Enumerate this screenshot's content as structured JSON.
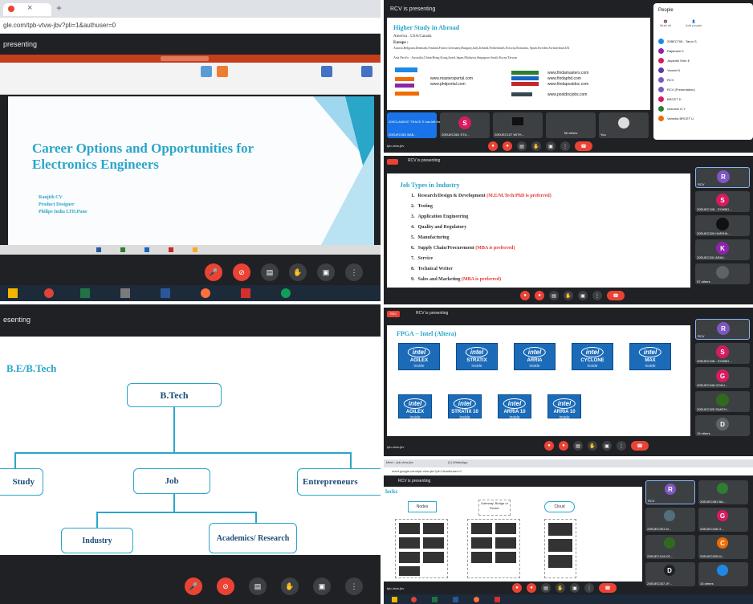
{
  "p1": {
    "url": "gle.com/tpb-vtvw-jbv?pli=1&authuser=0",
    "presenting": "presenting",
    "title": "Career Options and Opportunities for Electronics Engineers",
    "author": [
      "Ranjith CV",
      "Product Designer",
      "Philips India LTD,Pune"
    ]
  },
  "p2": {
    "presenting": "RCV is presenting",
    "slide_title": "Higher Study in Abroad",
    "america": "America : USA/Canada",
    "europe_label": "Europe :",
    "europe": "Austria,Belgium,Denmark,Finland,France,Germany,Hungary,Italy,Ireland,Netherlands,Norway,Romania, Spain,Sweden,Switzerland,UK",
    "asia": "Asia Pacific : Australia,China,Hong Kong,Israel,Japan,Malaysia,Singapore,South Korea,Taiwan",
    "sites_left": [
      "www.mastersportal.com",
      "www.phdportal.com"
    ],
    "sites_right": [
      "www.findamasters.com",
      "www.findaphd.com",
      "www.findapostdoc.com",
      "www.postdocjobs.com"
    ],
    "people_title": "People",
    "people_actions": [
      "Mute all",
      "Add people"
    ],
    "people": [
      "20BEC708 - Tarun S",
      "Rajamahi C",
      "Jayanthi Sree E",
      "Yamini N",
      "RCV",
      "RCV (Presentation)",
      "BRCET D",
      "sharmini D.Y",
      "Vamsha BRCET U"
    ],
    "toast": "20ECLA08037 TRACE S has left the meeting",
    "tile_labels": [
      "20EUEC081 BAB...",
      "20EUEC081 STU...",
      "20EUEC107 WITH...",
      "56 others",
      "You"
    ],
    "tile_letter": "S",
    "footer": "tpb-vtvw-jbv"
  },
  "p3": {
    "presenting": "RCV is presenting",
    "slide_title": "Job Types in Industry",
    "items": [
      {
        "n": "1.",
        "t": "Research/Design & Development ",
        "r": "(M.E/M.Tech/PhD is preferred)"
      },
      {
        "n": "2.",
        "t": "Testing",
        "r": ""
      },
      {
        "n": "3.",
        "t": "Application Engineering",
        "r": ""
      },
      {
        "n": "4.",
        "t": "Quality and Regulatory",
        "r": ""
      },
      {
        "n": "5.",
        "t": "Manufacturing",
        "r": ""
      },
      {
        "n": "6.",
        "t": "Supply Chain/Procurement ",
        "r": "(MBA is preferred)"
      },
      {
        "n": "7.",
        "t": "Service",
        "r": ""
      },
      {
        "n": "8.",
        "t": "Technical Writer",
        "r": ""
      },
      {
        "n": "9.",
        "t": "Sales and Marketing ",
        "r": "(MBA is preferred)"
      }
    ],
    "side": [
      {
        "letter": "R",
        "label": "RCV",
        "color": "#7e57c2"
      },
      {
        "letter": "S",
        "label": "20EUEC108 - SYMBO...",
        "color": "#d81b60"
      },
      {
        "letter": "",
        "label": "20EUEC026 HARIHA...",
        "color": "#111111"
      },
      {
        "letter": "K",
        "label": "20EUEC031 ARAV...",
        "color": "#8e24aa"
      },
      {
        "letter": "",
        "label": "57 others",
        "color": "#5f6368"
      }
    ]
  },
  "p4": {
    "presenting": "esenting",
    "heading": "B.E/B.Tech",
    "root": "B.Tech",
    "left": "Study",
    "middle": "Job",
    "right": "Entrepreneurs",
    "child1": "Industry",
    "child2": "Academics/ Research"
  },
  "p5": {
    "rec": "REC",
    "presenting": "RCV is presenting",
    "slide_title": "FPGA – Intel (Altera)",
    "chips_row1": [
      "AGILEX",
      "STRATIX",
      "ARRIA",
      "CYCLONE",
      "MAX"
    ],
    "chips_row2": [
      "AGILEX",
      "STRATIX 10",
      "ARRIA 10",
      "ARRIA 10"
    ],
    "intel": "intel",
    "inside": "inside",
    "side": [
      {
        "letter": "R",
        "label": "RCV",
        "color": "#7e57c2"
      },
      {
        "letter": "S",
        "label": "20EUEC108 - SYMBO...",
        "color": "#d81b60"
      },
      {
        "letter": "G",
        "label": "20EUEC048 GOKU...",
        "color": "#d81b60"
      },
      {
        "letter": "",
        "label": "20EUEC025 SANTH...",
        "color": "#33691e"
      },
      {
        "letter": "D",
        "label": "19 others",
        "color": "#5f6368"
      }
    ],
    "footer": "tpb-vtvw-jbv"
  },
  "p6": {
    "tab": "Meet - tpb-vtvw-jbv",
    "tab2": "(1) WhatsApp",
    "url": "meet.google.com/tpb-vtvw-jbv?pli=1&authuser=0",
    "presenting": "RCV is presenting",
    "slide_title": "locks",
    "boxes": [
      "Nodes",
      "Gateway, Bridge or Router",
      "Cloud"
    ],
    "grid": [
      {
        "letter": "R",
        "label": "RCV",
        "color": "#7e57c2"
      },
      {
        "letter": "",
        "label": "20EUEC081 BA...",
        "color": "#2e7d32"
      },
      {
        "letter": "",
        "label": "20EUEC001 M...",
        "color": "#546e7a"
      },
      {
        "letter": "G",
        "label": "20EUEC048 G...",
        "color": "#d81b60"
      },
      {
        "letter": "",
        "label": "20EUEC104 KS...",
        "color": "#33691e"
      },
      {
        "letter": "C",
        "label": "20EUEC025 M...",
        "color": "#ef6c00"
      },
      {
        "letter": "D",
        "label": "20EUEC037 JF...",
        "color": "#202124"
      },
      {
        "letter": "",
        "label": "15 others",
        "color": "#1e88e5"
      }
    ],
    "footer": "tpb-vtvw-jbv"
  }
}
